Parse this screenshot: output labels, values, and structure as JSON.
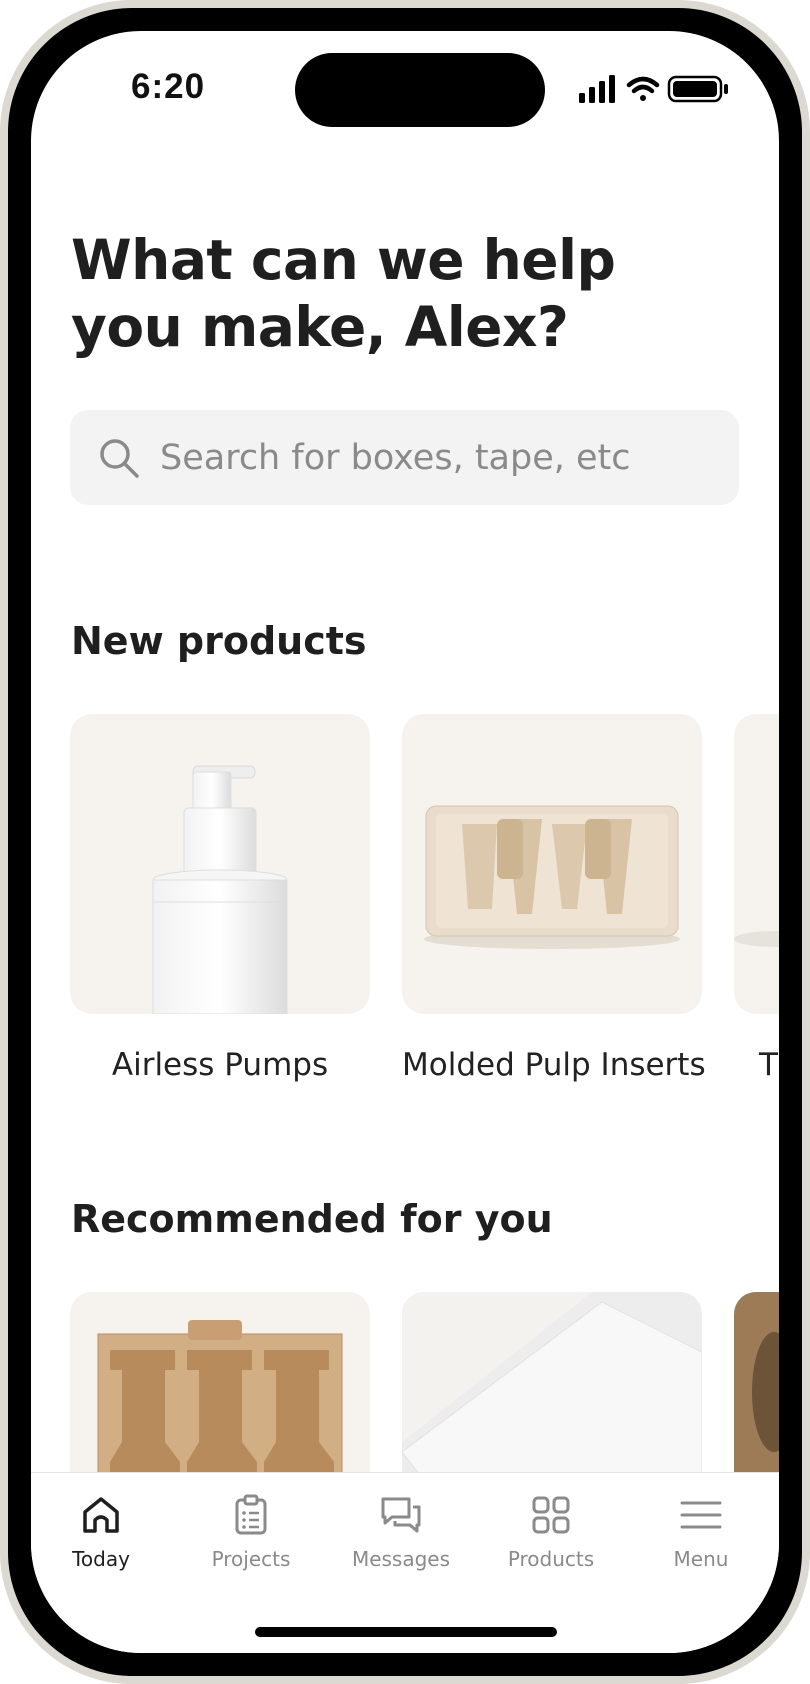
{
  "status_bar": {
    "time": "6:20"
  },
  "greeting": {
    "headline": "What can we help you make, Alex?"
  },
  "search": {
    "placeholder": "Search for boxes, tape, etc"
  },
  "new_products": {
    "title": "New products",
    "items": [
      {
        "label": "Airless Pumps"
      },
      {
        "label": "Molded Pulp Inserts"
      },
      {
        "label": "T"
      }
    ]
  },
  "recommended": {
    "title": "Recommended for you"
  },
  "tab_bar": {
    "items": [
      {
        "label": "Today",
        "icon": "home-icon",
        "active": true
      },
      {
        "label": "Projects",
        "icon": "clipboard-icon"
      },
      {
        "label": "Messages",
        "icon": "chat-icon"
      },
      {
        "label": "Products",
        "icon": "grid-icon"
      },
      {
        "label": "Menu",
        "icon": "hamburger-icon"
      }
    ]
  },
  "colors": {
    "card_bg": "#f6f3ee",
    "search_bg": "#f3f3f3",
    "text_dark": "#1f1f1f",
    "tab_inactive": "#8a8a8a"
  }
}
